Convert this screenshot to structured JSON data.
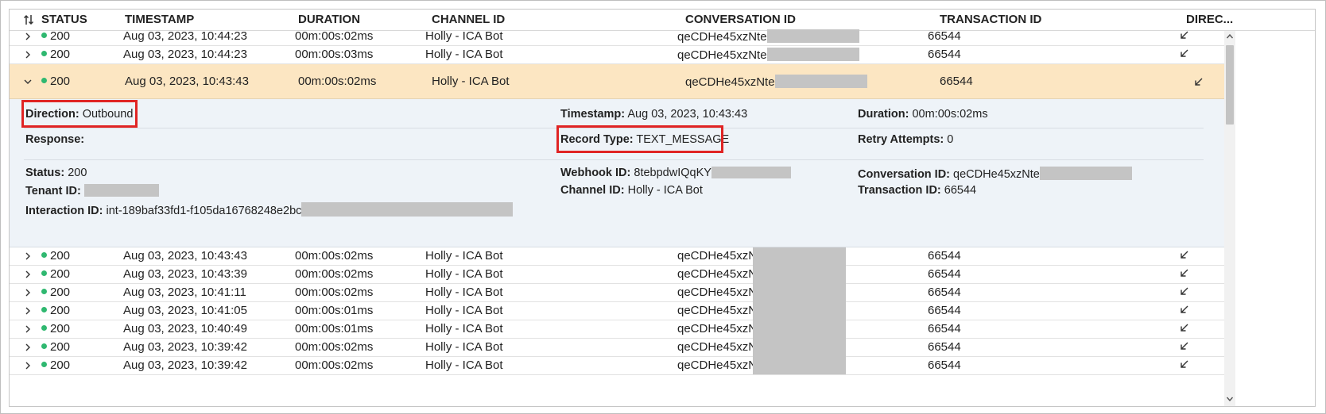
{
  "columns": {
    "status": "STATUS",
    "timestamp": "TIMESTAMP",
    "duration": "DURATION",
    "channel_id": "CHANNEL ID",
    "conversation_id": "CONVERSATION ID",
    "transaction_id": "TRANSACTION ID",
    "direction": "DIREC..."
  },
  "rows_top": [
    {
      "status": "200",
      "timestamp": "Aug 03, 2023, 10:44:23",
      "duration": "00m:00s:02ms",
      "channel": "Holly - ICA Bot",
      "conversation": "qeCDHe45xzNte",
      "transaction": "66544"
    },
    {
      "status": "200",
      "timestamp": "Aug 03, 2023, 10:44:23",
      "duration": "00m:00s:03ms",
      "channel": "Holly - ICA Bot",
      "conversation": "qeCDHe45xzNte",
      "transaction": "66544"
    }
  ],
  "expanded_row": {
    "status": "200",
    "timestamp": "Aug 03, 2023, 10:43:43",
    "duration": "00m:00s:02ms",
    "channel": "Holly - ICA Bot",
    "conversation": "qeCDHe45xzNte",
    "transaction": "66544"
  },
  "details": {
    "direction_label": "Direction:",
    "direction_value": "Outbound",
    "timestamp_label": "Timestamp:",
    "timestamp_value": "Aug 03, 2023, 10:43:43",
    "duration_label": "Duration:",
    "duration_value": "00m:00s:02ms",
    "response_label": "Response:",
    "record_type_label": "Record Type:",
    "record_type_value": "TEXT_MESSAGE",
    "retry_label": "Retry Attempts:",
    "retry_value": "0",
    "status_label": "Status:",
    "status_value": "200",
    "webhook_label": "Webhook ID:",
    "webhook_value": "8tebpdwIQqKY",
    "conversation_label": "Conversation ID:",
    "conversation_value": "qeCDHe45xzNte",
    "tenant_label": "Tenant ID:",
    "channel_label": "Channel ID:",
    "channel_value": "Holly - ICA Bot",
    "transaction_label": "Transaction ID:",
    "transaction_value": "66544",
    "interaction_label": "Interaction ID:",
    "interaction_value": "int-189baf33fd1-f105da16768248e2bc"
  },
  "rows_bottom": [
    {
      "status": "200",
      "timestamp": "Aug 03, 2023, 10:43:43",
      "duration": "00m:00s:02ms",
      "channel": "Holly - ICA Bot",
      "conversation": "qeCDHe45xzNte",
      "transaction": "66544"
    },
    {
      "status": "200",
      "timestamp": "Aug 03, 2023, 10:43:39",
      "duration": "00m:00s:02ms",
      "channel": "Holly - ICA Bot",
      "conversation": "qeCDHe45xzNte",
      "transaction": "66544"
    },
    {
      "status": "200",
      "timestamp": "Aug 03, 2023, 10:41:11",
      "duration": "00m:00s:02ms",
      "channel": "Holly - ICA Bot",
      "conversation": "qeCDHe45xzNte",
      "transaction": "66544"
    },
    {
      "status": "200",
      "timestamp": "Aug 03, 2023, 10:41:05",
      "duration": "00m:00s:01ms",
      "channel": "Holly - ICA Bot",
      "conversation": "qeCDHe45xzNte",
      "transaction": "66544"
    },
    {
      "status": "200",
      "timestamp": "Aug 03, 2023, 10:40:49",
      "duration": "00m:00s:01ms",
      "channel": "Holly - ICA Bot",
      "conversation": "qeCDHe45xzNte",
      "transaction": "66544"
    },
    {
      "status": "200",
      "timestamp": "Aug 03, 2023, 10:39:42",
      "duration": "00m:00s:02ms",
      "channel": "Holly - ICA Bot",
      "conversation": "qeCDHe45xzNte",
      "transaction": "66544"
    },
    {
      "status": "200",
      "timestamp": "Aug 03, 2023, 10:39:42",
      "duration": "00m:00s:02ms",
      "channel": "Holly - ICA Bot",
      "conversation": "qeCDHe45xzNte",
      "transaction": "66544"
    }
  ],
  "colors": {
    "status_ok": "#2fb870",
    "expanded_bg": "#fce6c2",
    "detail_bg": "#eef3f8",
    "highlight": "#e02424",
    "redaction": "#c4c4c4"
  },
  "icons": {
    "sort": "sort-arrows-icon",
    "collapsed": "chevron-right-icon",
    "expanded": "chevron-down-icon",
    "direction": "arrow-down-left-icon"
  }
}
